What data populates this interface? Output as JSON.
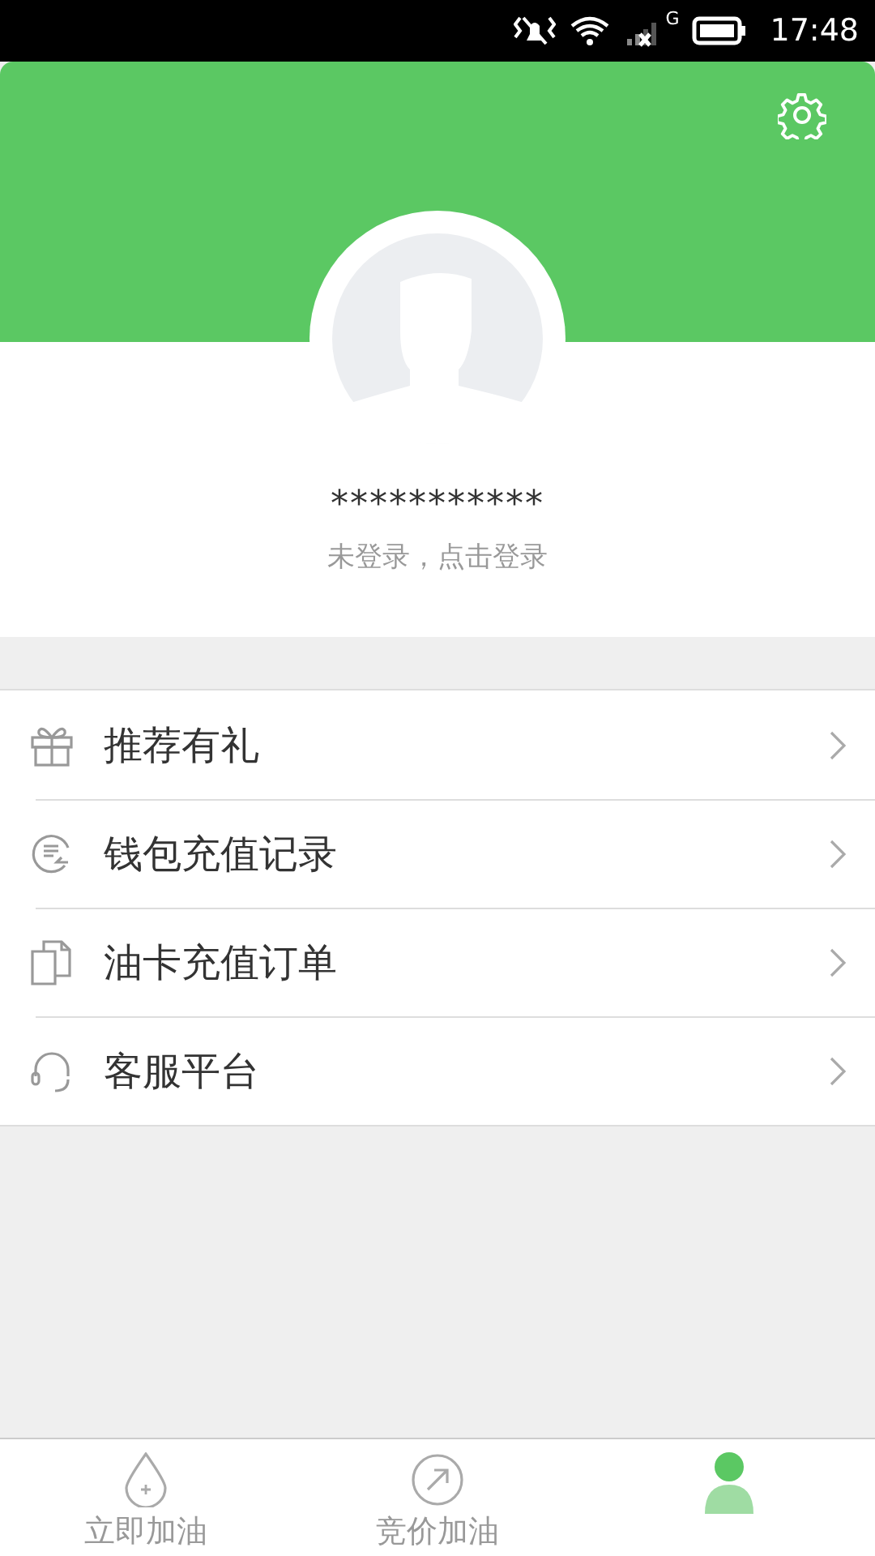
{
  "status_bar": {
    "network_type": "G",
    "time": "17:48"
  },
  "profile": {
    "username": "***********",
    "login_hint": "未登录，点击登录"
  },
  "menu": [
    {
      "kind": "gift",
      "label": "推荐有礼"
    },
    {
      "kind": "wallet",
      "label": "钱包充值记录"
    },
    {
      "kind": "document",
      "label": "油卡充值订单"
    },
    {
      "kind": "headset",
      "label": "客服平台"
    }
  ],
  "tabs": [
    {
      "kind": "drop",
      "label": "立即加油",
      "selected": false
    },
    {
      "kind": "arrow",
      "label": "竞价加油",
      "selected": false
    },
    {
      "kind": "person",
      "selected": true
    }
  ]
}
